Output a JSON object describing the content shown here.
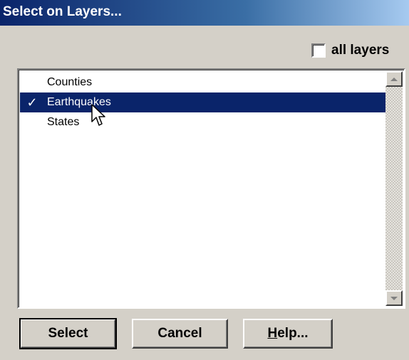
{
  "window": {
    "title": "Select on Layers..."
  },
  "all_layers": {
    "label": "all layers",
    "checked": false
  },
  "layers": [
    {
      "name": "Counties",
      "checked": false,
      "selected": false
    },
    {
      "name": "Earthquakes",
      "checked": true,
      "selected": true
    },
    {
      "name": "States",
      "checked": false,
      "selected": false
    }
  ],
  "check_glyph": "✓",
  "buttons": {
    "select": "Select",
    "cancel": "Cancel",
    "help_hotkey": "H",
    "help_rest": "elp..."
  },
  "colors": {
    "dialog_bg": "#d4d0c8",
    "title_start": "#0a246a",
    "title_end": "#a6caf0",
    "selection": "#0a246a"
  },
  "icons": {
    "checkbox": "checkbox-icon",
    "check": "checkmark-icon",
    "scroll_up": "arrow-up-icon",
    "scroll_down": "arrow-down-icon",
    "cursor": "mouse-pointer-icon"
  }
}
